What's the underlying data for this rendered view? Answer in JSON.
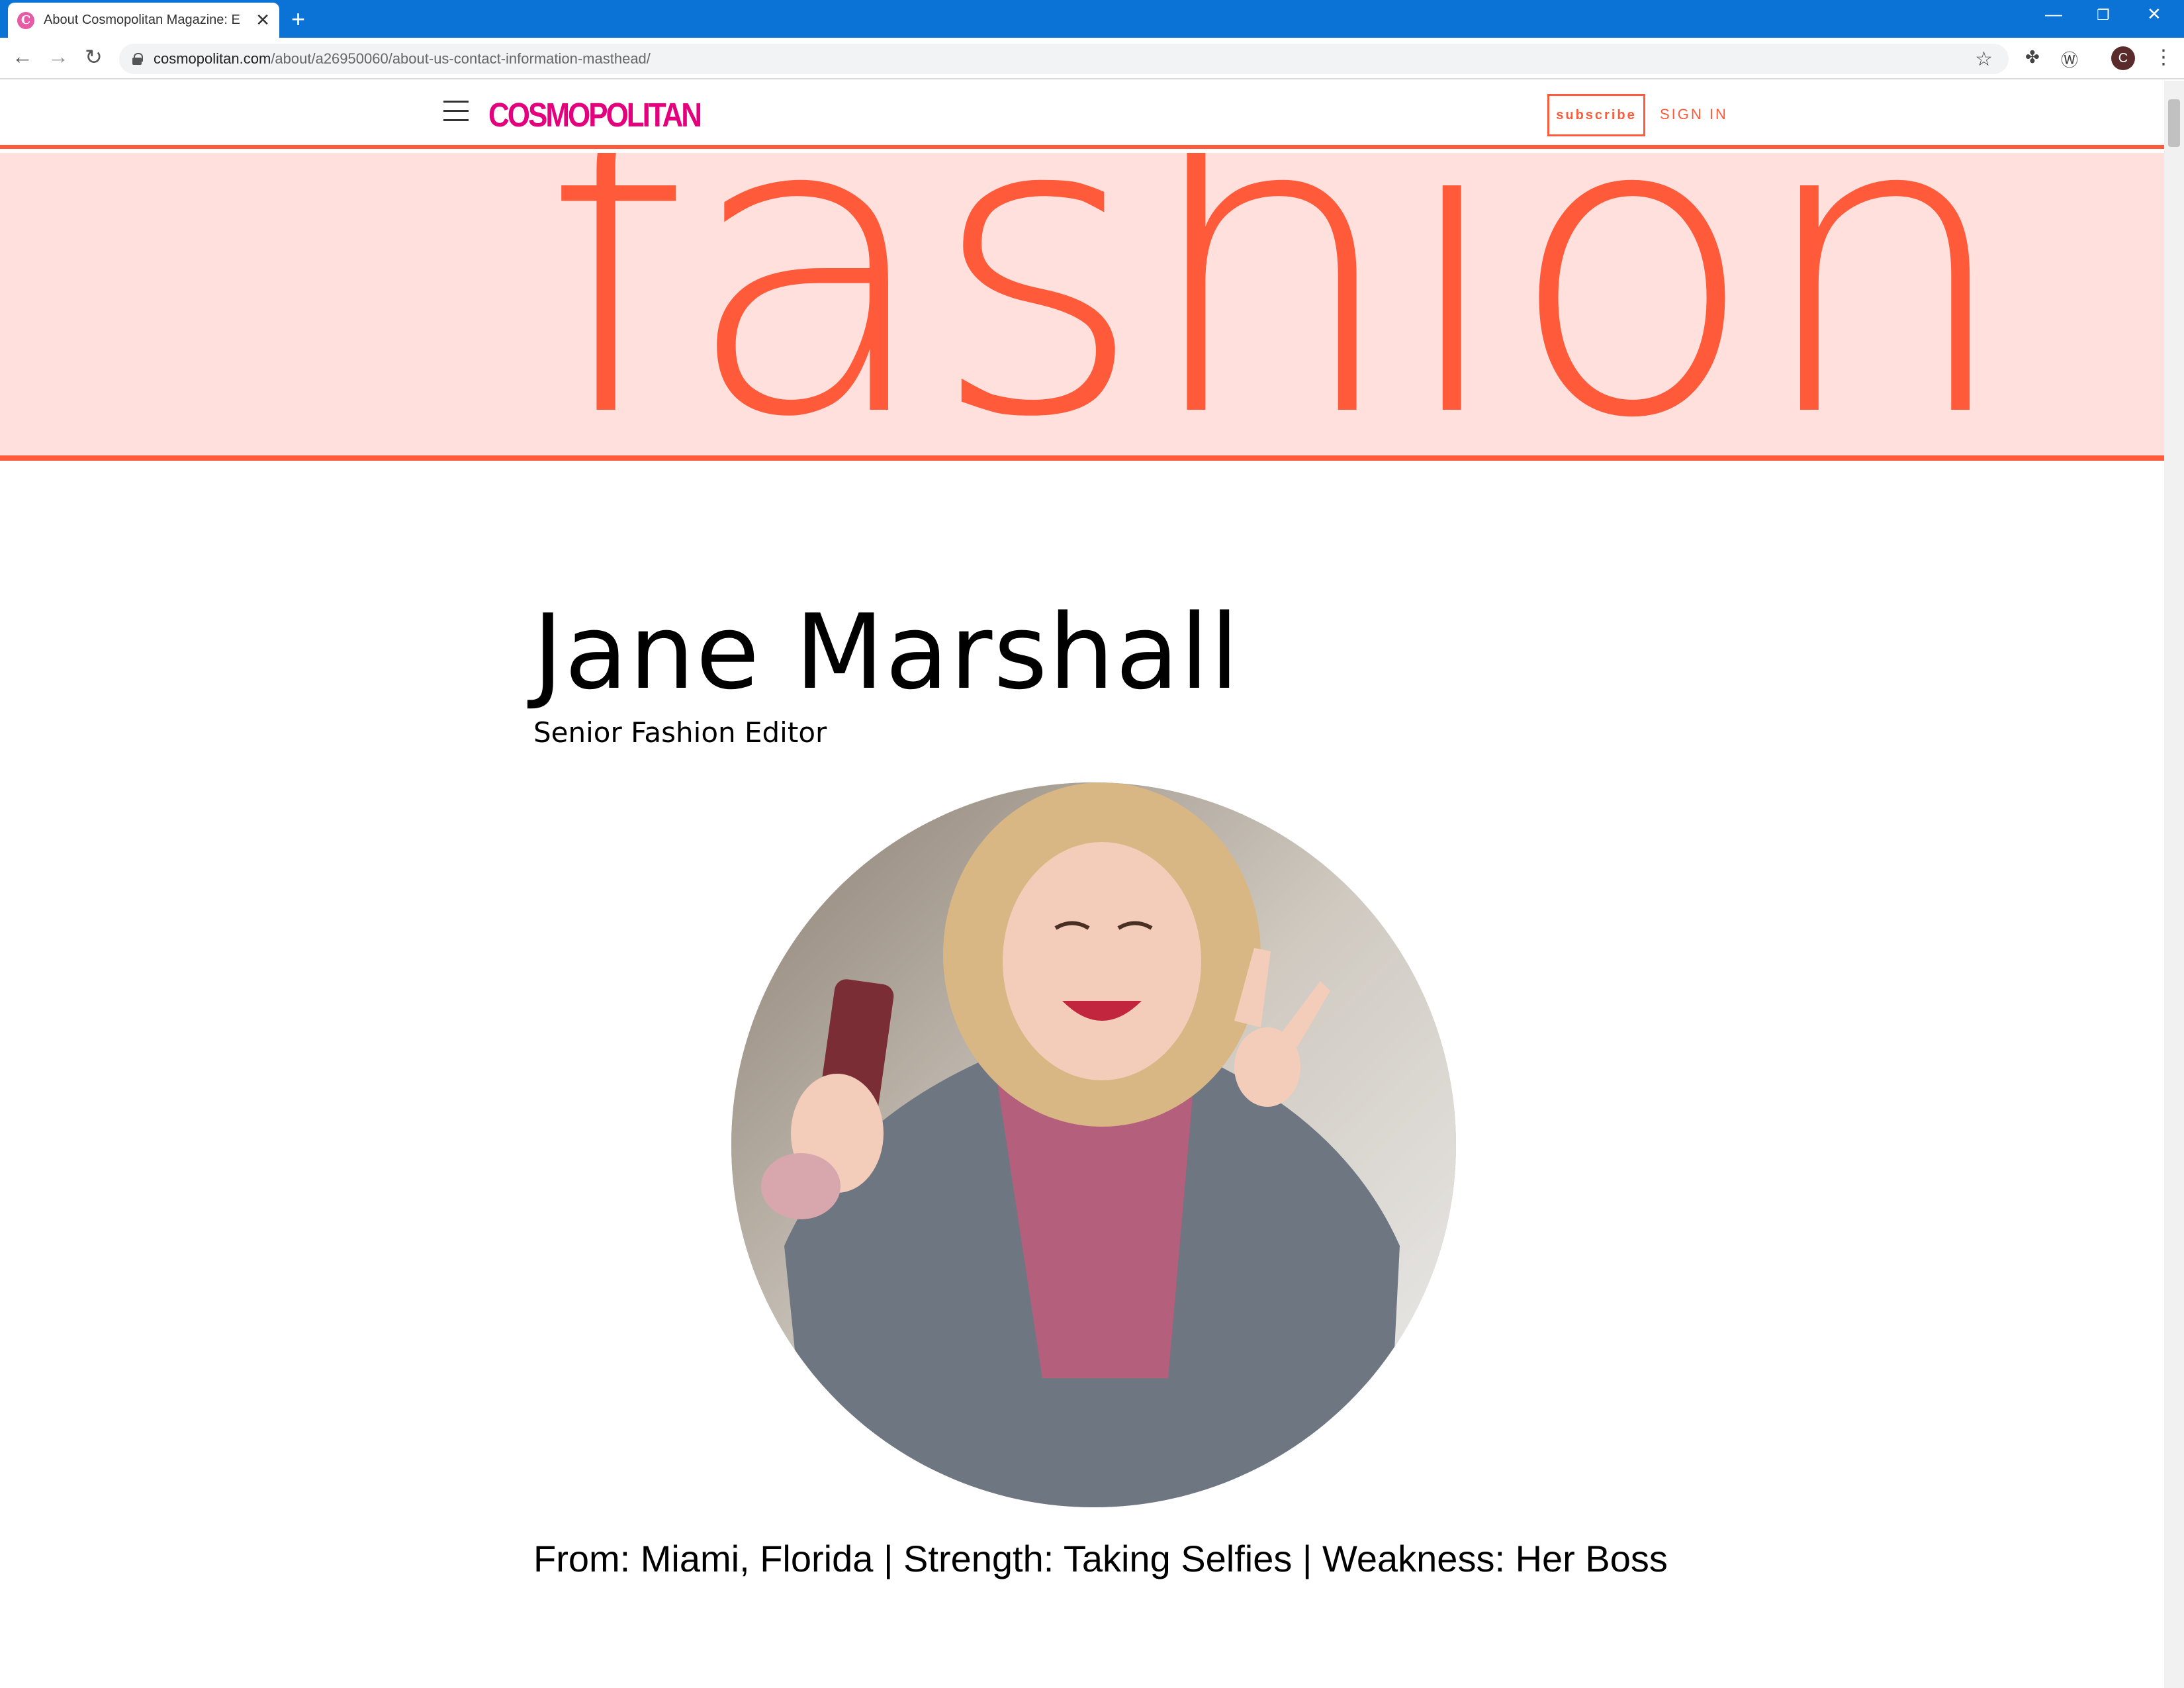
{
  "browser": {
    "tab_title": "About Cosmopolitan Magazine: E",
    "tab_favicon_letter": "C",
    "url_domain": "cosmopolitan.com",
    "url_path": "/about/a26950060/about-us-contact-information-masthead/",
    "profile_initial": "C"
  },
  "site": {
    "logo_text": "COSMOPOLITAN",
    "subscribe_label": "subscribe",
    "signin_label": "SIGN IN",
    "banner_word": "fashion",
    "accent_color": "#ff5b3b",
    "logo_color": "#e4007c",
    "banner_bg": "#ffe0dd"
  },
  "profile": {
    "name": "Jane Marshall",
    "role": "Senior Fashion Editor",
    "bio_line": "From: Miami, Florida | Strength: Taking Selfies | Weakness: Her Boss"
  }
}
